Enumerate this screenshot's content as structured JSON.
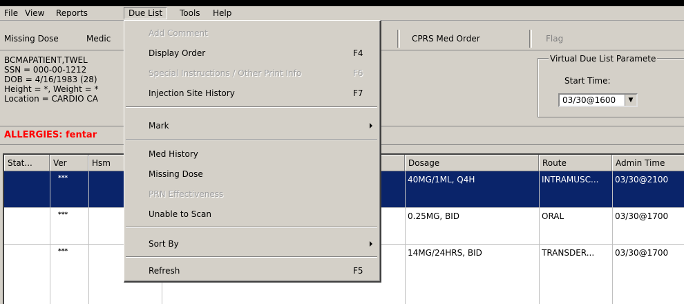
{
  "menubar": {
    "items": [
      {
        "label": "File"
      },
      {
        "label": "View"
      },
      {
        "label": "Reports"
      },
      {
        "label": "Due List"
      },
      {
        "label": "Tools"
      },
      {
        "label": "Help"
      }
    ]
  },
  "toolbar": {
    "missing_dose": "Missing Dose",
    "medic_truncated": "Medic",
    "cprs_med_order": "CPRS Med Order",
    "flag": "Flag"
  },
  "patient": {
    "name": "BCMAPATIENT,TWEL",
    "ssn": "SSN = 000-00-1212",
    "dob": "DOB = 4/16/1983 (28)",
    "height_weight": "Height = *, Weight = *",
    "location": "Location = CARDIO CA"
  },
  "virtual_due_list": {
    "title": "Virtual Due List Paramete",
    "start_time_label": "Start Time:",
    "start_time_value": "03/30@1600"
  },
  "allergies": "ALLERGIES: fentar",
  "grid": {
    "headers": [
      "Stat...",
      "Ver",
      "Hsm",
      "Dosage",
      "Route",
      "Admin Time"
    ],
    "rows": [
      {
        "ver": "***",
        "dosage": "40MG/1ML, Q4H",
        "route": "INTRAMUSC...",
        "admin": "03/30@2100"
      },
      {
        "ver": "***",
        "dosage": "0.25MG, BID",
        "route": "ORAL",
        "admin": "03/30@1700"
      },
      {
        "ver": "***",
        "dosage": "14MG/24HRS, BID",
        "route": "TRANSDER...",
        "admin": "03/30@1700"
      }
    ]
  },
  "due_list_menu": {
    "add_comment": "Add Comment",
    "display_order": "Display Order",
    "display_order_key": "F4",
    "special_instructions": "Special Instructions / Other Print Info",
    "special_instructions_key": "F6",
    "injection_site_history": "Injection Site History",
    "injection_site_history_key": "F7",
    "mark": "Mark",
    "med_history": "Med History",
    "missing_dose": "Missing Dose",
    "prn_effectiveness": "PRN Effectiveness",
    "unable_to_scan": "Unable to Scan",
    "sort_by": "Sort By",
    "refresh": "Refresh",
    "refresh_key": "F5"
  },
  "colors": {
    "window_bg": "#d4d0c8",
    "selection": "#0a246a",
    "allergy_red": "#ff0000"
  }
}
